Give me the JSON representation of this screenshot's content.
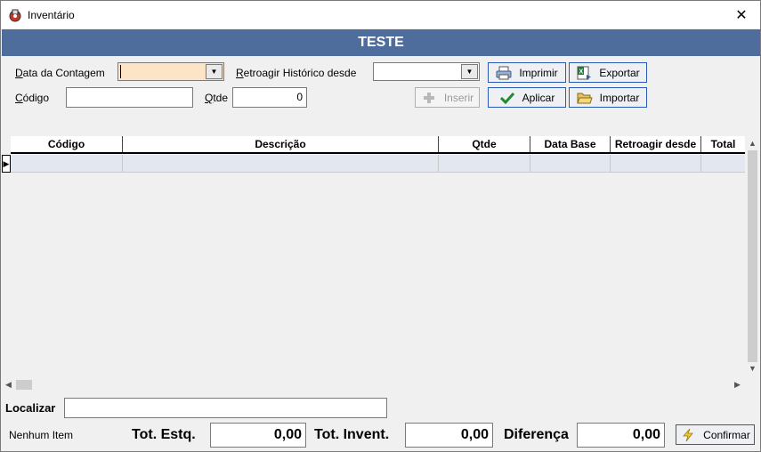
{
  "window": {
    "title": "Inventário",
    "close_symbol": "✕"
  },
  "banner": {
    "title": "TESTE"
  },
  "form": {
    "data_contagem_label_u": "D",
    "data_contagem_label_rest": "ata da Contagem",
    "retroagir_label_u": "R",
    "retroagir_label_rest": "etroagir Histórico desde",
    "codigo_label_u": "C",
    "codigo_label_rest": "ódigo",
    "codigo_value": "",
    "qtde_label_u": "Q",
    "qtde_label_rest": "tde",
    "qtde_value": "0"
  },
  "buttons": {
    "imprimir": "Imprimir",
    "exportar": "Exportar",
    "inserir": "Inserir",
    "aplicar": "Aplicar",
    "importar": "Importar",
    "confirmar": "Confirmar"
  },
  "grid": {
    "columns": [
      "Código",
      "Descrição",
      "Qtde",
      "Data Base",
      "Retroagir desde",
      "Total"
    ]
  },
  "footer": {
    "localizar_label": "Localizar",
    "localizar_value": "",
    "status": "Nenhum Item",
    "tot_estq_label": "Tot. Estq.",
    "tot_estq_value": "0,00",
    "tot_invent_label": "Tot. Invent.",
    "tot_invent_value": "0,00",
    "diferenca_label": "Diferença",
    "diferenca_value": "0,00"
  },
  "colors": {
    "banner": "#4f6d9c",
    "date_field": "#fde4c6",
    "selected_row": "#e2e7f0"
  }
}
